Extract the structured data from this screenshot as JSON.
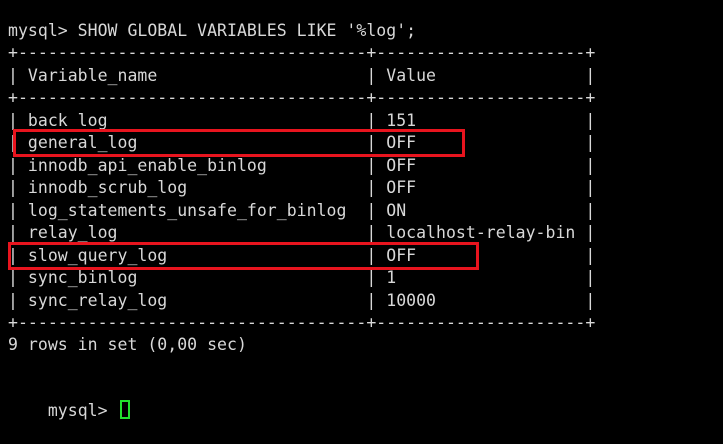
{
  "command_line": "mysql> SHOW GLOBAL VARIABLES LIKE '%log';",
  "border_line": "+-----------------------------------+---------------------+",
  "header_line": "| Variable_name                     | Value               |",
  "rows": [
    "| back_log                          | 151                 |",
    "| general_log                       | OFF                 |",
    "| innodb_api_enable_binlog          | OFF                 |",
    "| innodb_scrub_log                  | OFF                 |",
    "| log_statements_unsafe_for_binlog  | ON                  |",
    "| relay_log                         | localhost-relay-bin |",
    "| slow_query_log                    | OFF                 |",
    "| sync_binlog                       | 1                   |",
    "| sync_relay_log                    | 10000               |"
  ],
  "result_summary": "9 rows in set (0,00 sec)",
  "prompt": "mysql> ",
  "highlighted_variables": [
    "general_log",
    "slow_query_log"
  ],
  "colors": {
    "background": "#000000",
    "text": "#d8d8d8",
    "highlight_border": "#e8141e",
    "cursor": "#22e22e"
  }
}
